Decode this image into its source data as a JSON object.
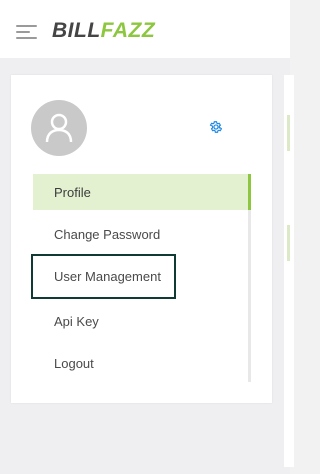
{
  "header": {
    "logo_part1": "BILL",
    "logo_part2": "FAZZ",
    "menu_icon": "hamburger-icon"
  },
  "profile": {
    "avatar_icon": "user-icon",
    "settings_icon": "gear-icon"
  },
  "menu": {
    "items": [
      {
        "label": "Profile",
        "active": true
      },
      {
        "label": "Change Password"
      },
      {
        "label": "User Management",
        "highlighted": true
      },
      {
        "label": "Api Key"
      },
      {
        "label": "Logout"
      }
    ]
  },
  "colors": {
    "brand_green": "#8dc63f",
    "active_bg": "#e4f1d1",
    "highlight_outline": "#0f3b34"
  }
}
